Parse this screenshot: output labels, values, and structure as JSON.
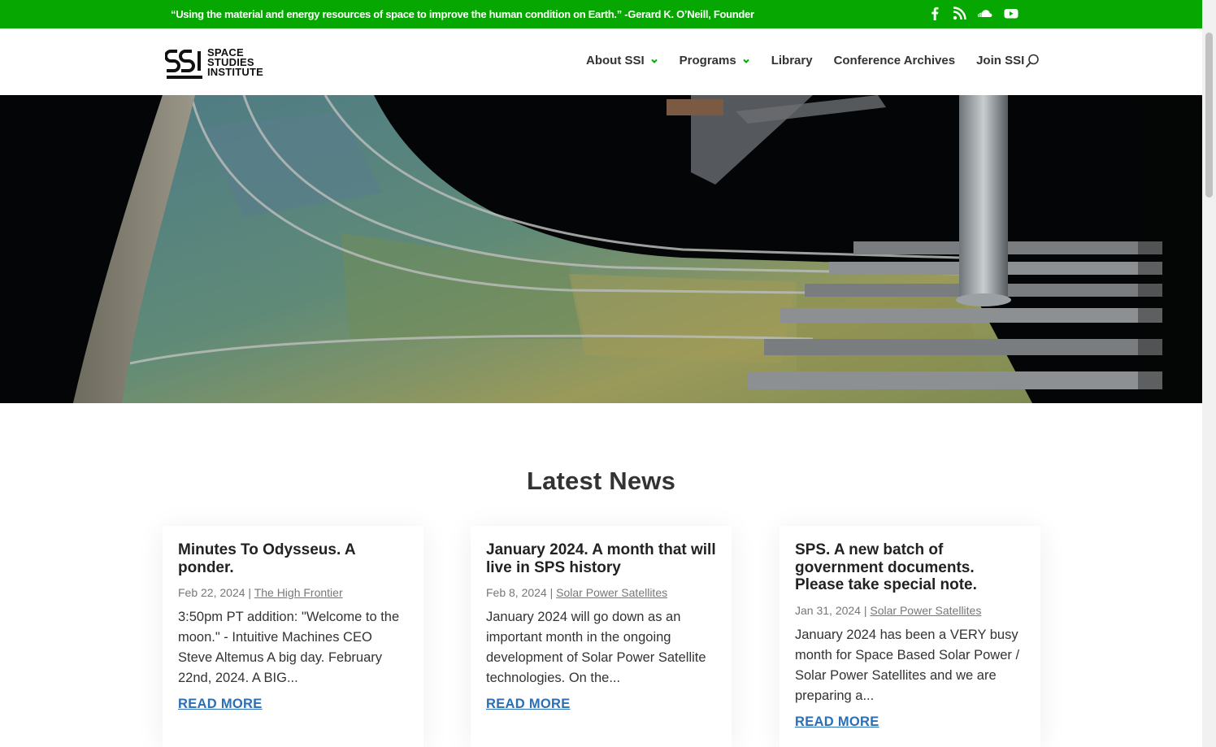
{
  "topbar": {
    "quote": "“Using the material and energy resources of space to improve the human condition on Earth.” -Gerard K. O’Neill, Founder",
    "social": [
      "facebook-icon",
      "rss-icon",
      "soundcloud-icon",
      "youtube-icon"
    ],
    "color": "#06a700"
  },
  "header": {
    "logo_mark": "SSI",
    "logo_lines": [
      "SPACE",
      "STUDIES",
      "INSTITUTE"
    ],
    "nav": [
      {
        "label": "About SSI",
        "dropdown": true
      },
      {
        "label": "Programs",
        "dropdown": true
      },
      {
        "label": "Library",
        "dropdown": false
      },
      {
        "label": "Conference Archives",
        "dropdown": false
      },
      {
        "label": "Join SSI",
        "dropdown": false
      }
    ],
    "search_icon": "search-icon"
  },
  "main": {
    "section_title": "Latest News",
    "posts": [
      {
        "title": "Minutes To Odysseus. A ponder.",
        "date": "Feb 22, 2024",
        "separator": "|",
        "category": "The High Frontier",
        "excerpt": "3:50pm PT addition: \"Welcome to the moon.\" - Intuitive Machines CEO Steve Altemus A big day. February 22nd, 2024. A BIG...",
        "read_more": "READ MORE"
      },
      {
        "title": "January 2024. A month that will live in SPS history",
        "date": "Feb 8, 2024",
        "separator": "|",
        "category": "Solar Power Satellites",
        "excerpt": "January 2024 will go down as an important month in the ongoing development of Solar Power Satellite technologies. On the...",
        "read_more": "READ MORE"
      },
      {
        "title": "SPS. A new batch of government documents. Please take special note.",
        "date": "Jan 31, 2024",
        "separator": "|",
        "category": "Solar Power Satellites",
        "excerpt": "January 2024 has been a VERY busy month for Space Based Solar Power / Solar Power Satellites and we are preparing a...",
        "read_more": "READ MORE"
      }
    ]
  },
  "colors": {
    "accent_green": "#06a700",
    "link_blue": "#2a6fb6"
  }
}
